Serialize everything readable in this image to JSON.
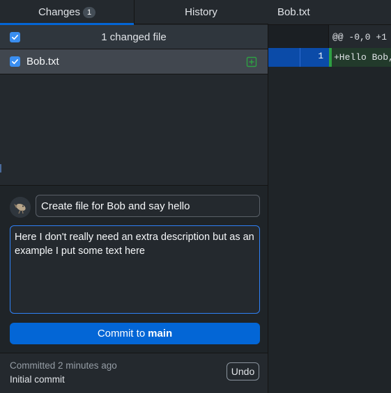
{
  "tabs": [
    {
      "label": "Changes",
      "badge": "1",
      "active": true
    },
    {
      "label": "History",
      "active": false
    }
  ],
  "changes": {
    "header_label": "1 changed file",
    "all_checked": true,
    "files": [
      {
        "name": "Bob.txt",
        "checked": true,
        "status_icon": "file-added-icon"
      }
    ]
  },
  "commit": {
    "summary_value": "Create file for Bob and say hello",
    "description_value": "Here I don't really need an extra description but as an example I put some text here",
    "button_prefix": "Commit to",
    "branch": "main",
    "avatar_icon": "user-avatar-icon"
  },
  "last_commit": {
    "time": "Committed 2 minutes ago",
    "message": "Initial commit",
    "undo_label": "Undo"
  },
  "diff": {
    "file_title": "Bob.txt",
    "hunk_header": "@@ -0,0 +1",
    "lines": [
      {
        "new_line_no": "1",
        "text": "+Hello Bob,"
      }
    ]
  },
  "colors": {
    "accent": "#0366d6",
    "added": "#2ea043",
    "checkbox": "#3a8ef0"
  }
}
